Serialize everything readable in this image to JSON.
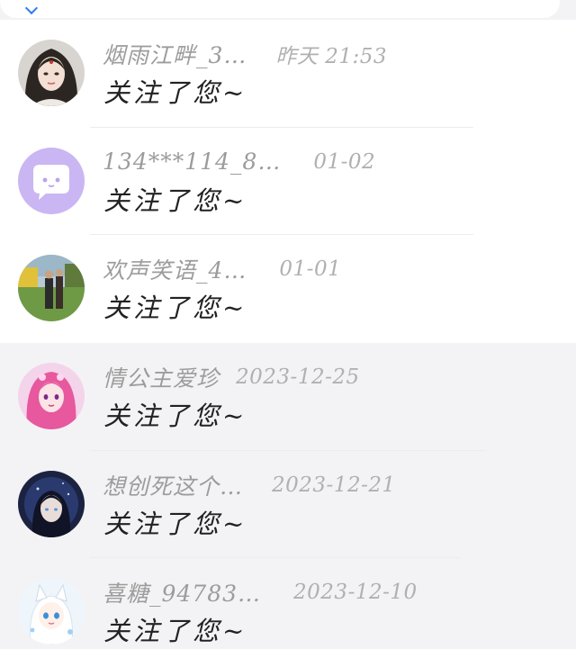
{
  "notifications": [
    {
      "name": "烟雨江畔_3…",
      "time": "昨天 21:53",
      "message": "关注了您~",
      "avatar": "ancient-style-woman-avatar"
    },
    {
      "name": "134***114_8…",
      "time": "01-02",
      "message": "关注了您~",
      "avatar": "purple-chat-bubble-avatar"
    },
    {
      "name": "欢声笑语_4…",
      "time": "01-01",
      "message": "关注了您~",
      "avatar": "couple-outdoor-photo-avatar"
    },
    {
      "name": "情公主爱珍",
      "time": "2023-12-25",
      "message": "关注了您~",
      "avatar": "pink-anime-girl-avatar"
    },
    {
      "name": "想创死这个…",
      "time": "2023-12-21",
      "message": "关注了您~",
      "avatar": "dark-anime-character-avatar"
    },
    {
      "name": "喜糖_94783…",
      "time": "2023-12-10",
      "message": "关注了您~",
      "avatar": "white-cat-girl-avatar"
    }
  ],
  "colors": {
    "accent": "#2d7cf0",
    "name_text": "#9c9c9c",
    "time_text": "#b0b0b0",
    "message_text": "#222222",
    "background": "#f3f3f5"
  }
}
